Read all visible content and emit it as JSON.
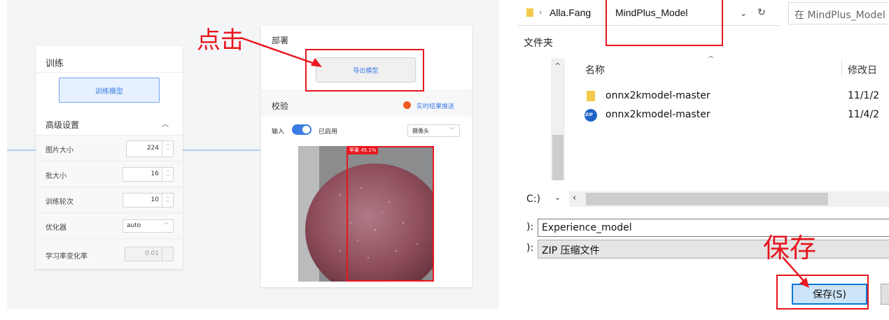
{
  "left": {
    "train": {
      "title": "训练",
      "button": "训练模型",
      "advanced": "高级设置",
      "advanced_chevron": "chevron-up-icon",
      "params": [
        {
          "label": "图片大小",
          "value": "224"
        },
        {
          "label": "批大小",
          "value": "16"
        },
        {
          "label": "训练轮次",
          "value": "10"
        },
        {
          "label": "优化器",
          "value": "auto"
        },
        {
          "label": "学习率变化率",
          "value": "0.01"
        }
      ]
    },
    "deploy": {
      "title": "部署",
      "export_button": "导出模型",
      "verify_title": "校验",
      "realtime_label": "实时结果推送",
      "input_label": "输入",
      "enabled_label": "已启用",
      "camera_select": "摄像头",
      "detection_label": "苹果 45.1%"
    },
    "callout": "点击",
    "accent_color": "#3b7be3",
    "annotation_color": "#e8171f"
  },
  "dialog": {
    "breadcrumb": [
      "Alla.Fang",
      "MindPlus_Model"
    ],
    "search_placeholder": "在 MindPlus_Model 中搜索",
    "new_folder": "文件夹",
    "columns": {
      "name": "名称",
      "date": "修改日"
    },
    "files": [
      {
        "name": "onnx2kmodel-master",
        "date": "11/1/2",
        "icon": "folder-icon"
      },
      {
        "name": "onnx2kmodel-master",
        "date": "11/4/2",
        "icon": "zip-icon"
      }
    ],
    "nav_drive": "C:)",
    "filename_label": "):",
    "filename_value": "Experience_model",
    "filetype_label": "):",
    "filetype_value": "ZIP 压缩文件",
    "save_button": "保存(S)",
    "callout": "保存"
  }
}
